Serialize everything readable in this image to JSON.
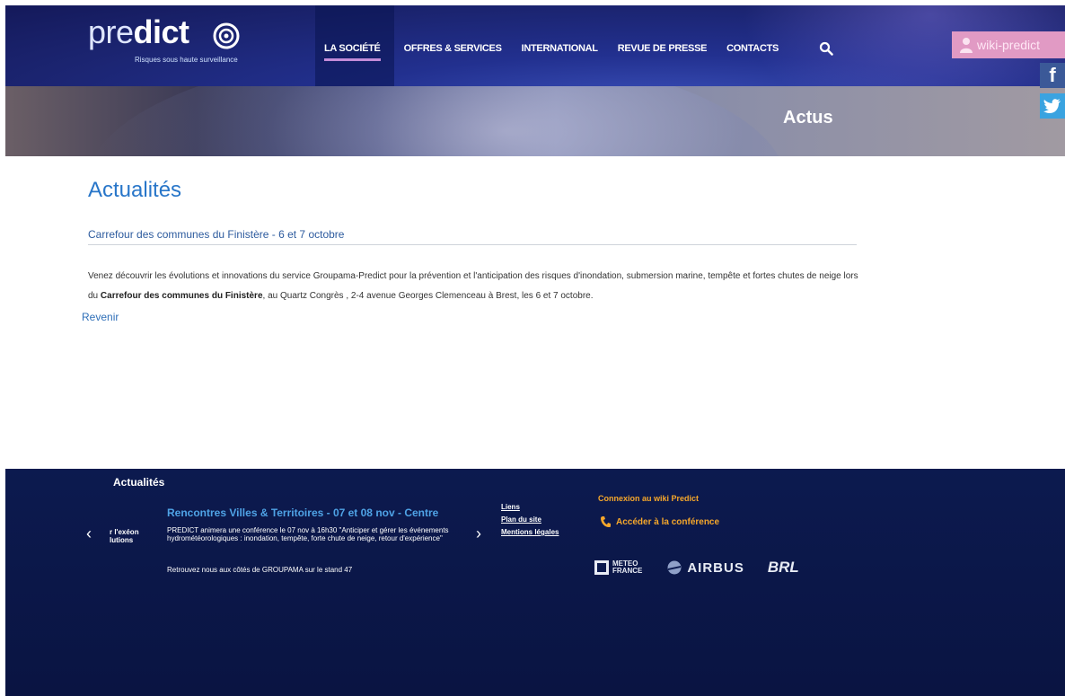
{
  "brand": {
    "logo_pre": "pre",
    "logo_dict": "dict",
    "tagline": "Risques sous haute surveillance"
  },
  "nav": {
    "items": [
      {
        "label": "LA SOCIÉTÉ",
        "active": true
      },
      {
        "label": "OFFRES & SERVICES",
        "active": false
      },
      {
        "label": "INTERNATIONAL",
        "active": false
      },
      {
        "label": "REVUE DE PRESSE",
        "active": false
      },
      {
        "label": "CONTACTS",
        "active": false
      }
    ],
    "search_icon": "search-icon"
  },
  "wiki_button": {
    "label": "wiki-predict"
  },
  "banner": {
    "title": "Actus"
  },
  "social": {
    "facebook": "f",
    "twitter": "twitter-icon"
  },
  "main": {
    "page_title": "Actualités",
    "article_title": "Carrefour des communes du Finistère - 6 et 7 octobre",
    "body_part1": "Venez découvrir les évolutions et innovations du service Groupama-Predict pour la prévention et l'anticipation des risques d'inondation, submersion marine, tempête et fortes chutes de neige lors du ",
    "body_bold": "Carrefour des communes du Finistère",
    "body_part2": ", au Quartz Congrès , 2-4 avenue Georges Clemenceau à Brest, les 6 et 7 octobre.",
    "back_link": "Revenir"
  },
  "footer": {
    "heading": "Actualités",
    "prev_snippet_line1": "r l'exéon",
    "prev_snippet_line2": "lutions",
    "news_title": "Rencontres Villes & Territoires - 07 et 08 nov - Centre",
    "news_desc": "PREDICT animera une conférence le 07 nov à 16h30 \"Anticiper et gérer les événements hydrométéorologiques : inondation, tempête, forte chute de neige, retour d'expérience\"",
    "news_extra": "Retrouvez nous aux côtés de GROUPAMA sur le stand 47",
    "links": [
      "Liens",
      "Plan du site",
      "Mentions légales"
    ],
    "wiki_login": "Connexion au wiki Predict",
    "conference": "Accéder à la conférence",
    "partners": {
      "meteo_line1": "METEO",
      "meteo_line2": "FRANCE",
      "airbus": "AIRBUS",
      "brl": "BRL"
    }
  },
  "colors": {
    "accent_blue": "#2876c9",
    "footer_bg": "#0c1a4f",
    "orange": "#f6a72b",
    "wiki_pink": "#e19ac4",
    "active_underline": "#c38cd8"
  }
}
